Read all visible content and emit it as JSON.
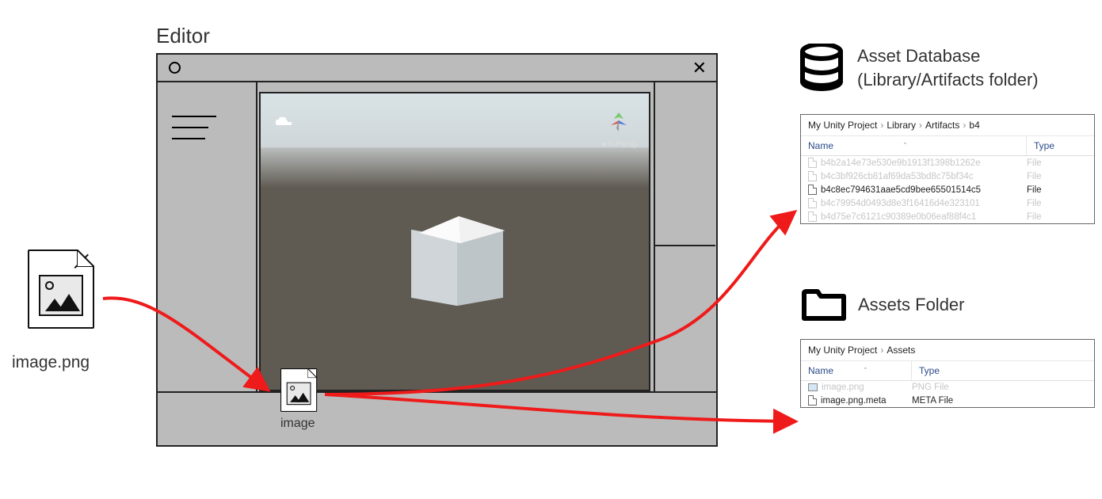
{
  "editor": {
    "title": "Editor",
    "scene": {
      "persp_label": "Persp",
      "gizmo_axes": [
        "x",
        "z"
      ]
    },
    "project_asset": {
      "label": "image"
    }
  },
  "source_file": {
    "label": "image.png"
  },
  "asset_db": {
    "title_line1": "Asset Database",
    "title_line2": "(Library/Artifacts folder)",
    "breadcrumb": [
      "My Unity Project",
      "Library",
      "Artifacts",
      "b4"
    ],
    "columns": {
      "name": "Name",
      "type": "Type"
    },
    "rows": [
      {
        "name": "b4b2a14e73e530e9b1913f1398b1262e",
        "type": "File",
        "dim": true
      },
      {
        "name": "b4c3bf926cb81af69da53bd8c75bf34c",
        "type": "File",
        "dim": true
      },
      {
        "name": "b4c8ec794631aae5cd9bee65501514c5",
        "type": "File",
        "dim": false
      },
      {
        "name": "b4c79954d0493d8e3f16416d4e323101",
        "type": "File",
        "dim": true
      },
      {
        "name": "b4d75e7c6121c90389e0b06eaf88f4c1",
        "type": "File",
        "dim": true
      }
    ]
  },
  "assets_folder": {
    "title": "Assets Folder",
    "breadcrumb": [
      "My Unity Project",
      "Assets"
    ],
    "columns": {
      "name": "Name",
      "type": "Type"
    },
    "rows": [
      {
        "name": "image.png",
        "type": "PNG File",
        "dim": true,
        "icon": "pic"
      },
      {
        "name": "image.png.meta",
        "type": "META File",
        "dim": false,
        "icon": "file"
      }
    ]
  }
}
